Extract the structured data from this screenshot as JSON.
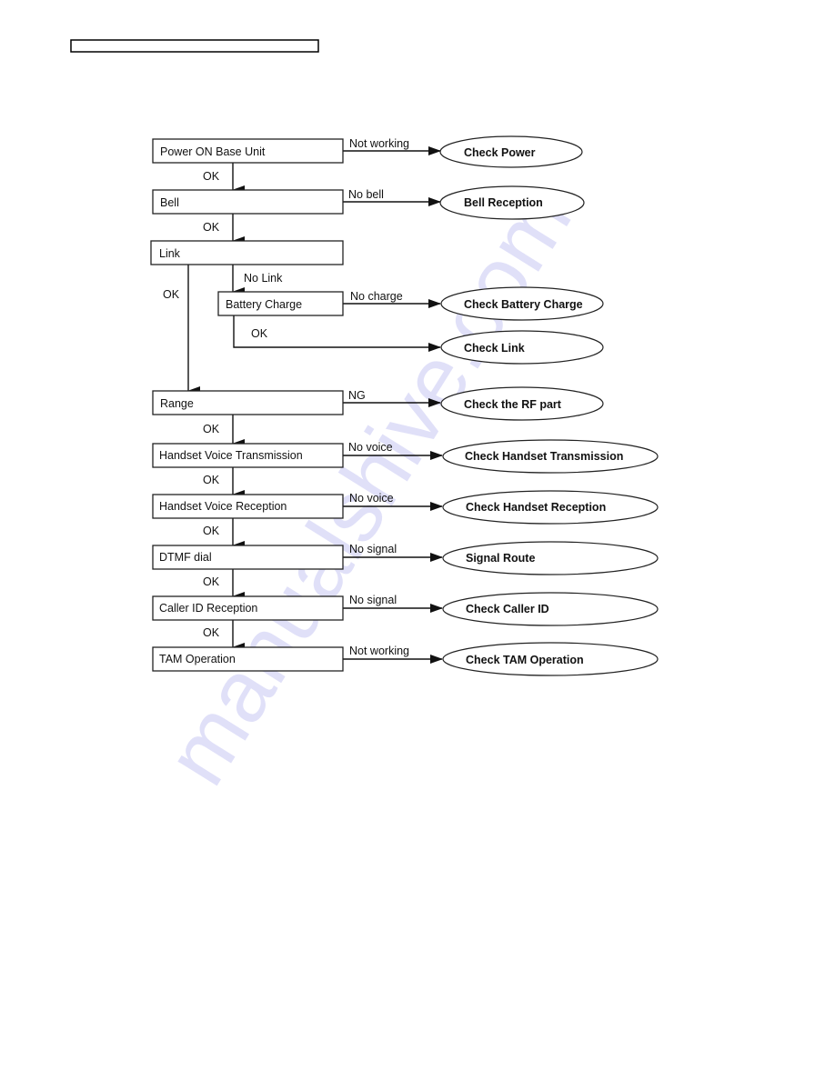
{
  "document": {
    "header_text": "",
    "watermark": "manualshive.com",
    "watermark_color": "#c8c8f4"
  },
  "flowchart": {
    "title": "",
    "steps": [
      {
        "id": "power",
        "label": "Power ON Base Unit",
        "fail_label": "Not working",
        "fail_action": "Check Power",
        "ok_label": "OK"
      },
      {
        "id": "bell",
        "label": "Bell",
        "fail_label": "No bell",
        "fail_action": "Bell Reception",
        "ok_label": "OK"
      },
      {
        "id": "link",
        "label": "Link",
        "fail_label": "No Link",
        "ok_label": "OK"
      },
      {
        "id": "battery",
        "label": "Battery Charge",
        "fail_label": "No charge",
        "fail_action": "Check Battery Charge",
        "ok_label": "OK",
        "ok_action": "Check Link"
      },
      {
        "id": "range",
        "label": "Range",
        "fail_label": "NG",
        "fail_action": "Check the RF part",
        "ok_label": "OK"
      },
      {
        "id": "hvt",
        "label": "Handset Voice Transmission",
        "fail_label": "No voice",
        "fail_action": "Check Handset Transmission",
        "ok_label": "OK"
      },
      {
        "id": "hvr",
        "label": "Handset Voice Reception",
        "fail_label": "No voice",
        "fail_action": "Check Handset Reception",
        "ok_label": "OK"
      },
      {
        "id": "dtmf",
        "label": "DTMF dial",
        "fail_label": "No signal",
        "fail_action": "Signal Route",
        "ok_label": "OK"
      },
      {
        "id": "callerid",
        "label": "Caller ID Reception",
        "fail_label": "No signal",
        "fail_action": "Check Caller ID",
        "ok_label": "OK"
      },
      {
        "id": "tam",
        "label": "TAM Operation",
        "fail_label": "Not working",
        "fail_action": "Check TAM Operation"
      }
    ]
  }
}
